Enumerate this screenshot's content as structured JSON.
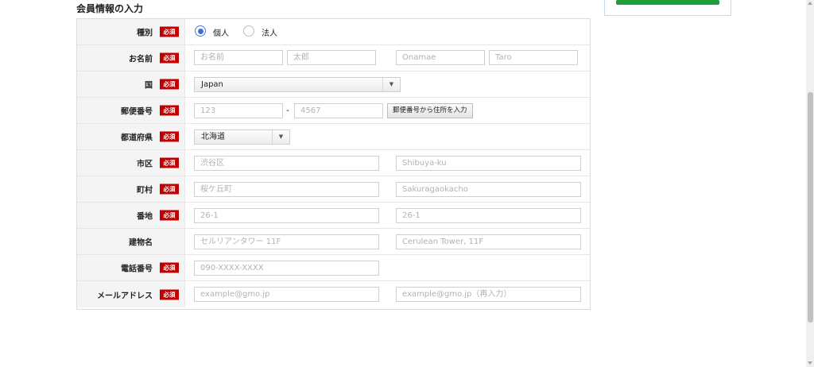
{
  "section_title": "会員情報の入力",
  "required_label": "必須",
  "rows": {
    "type": {
      "label": "種別",
      "options": [
        {
          "label": "個人",
          "checked": true
        },
        {
          "label": "法人",
          "checked": false
        }
      ]
    },
    "name": {
      "label": "お名前",
      "placeholders": [
        "お名前",
        "太郎",
        "Onamae",
        "Taro"
      ]
    },
    "country": {
      "label": "国",
      "selected": "Japan"
    },
    "postal": {
      "label": "郵便番号",
      "placeholders": [
        "123",
        "4567"
      ],
      "separator": "-",
      "button": "郵便番号から住所を入力"
    },
    "prefecture": {
      "label": "都道府県",
      "selected": "北海道"
    },
    "city": {
      "label": "市区",
      "placeholders": [
        "渋谷区",
        "Shibuya-ku"
      ]
    },
    "town": {
      "label": "町村",
      "placeholders": [
        "桜ケ丘町",
        "Sakuragaokacho"
      ]
    },
    "block": {
      "label": "番地",
      "placeholders": [
        "26-1",
        "26-1"
      ]
    },
    "building": {
      "label": "建物名",
      "placeholders": [
        "セルリアンタワー 11F",
        "Cerulean Tower, 11F"
      ]
    },
    "phone": {
      "label": "電話番号",
      "placeholders": [
        "090-XXXX-XXXX"
      ]
    },
    "email": {
      "label": "メールアドレス",
      "placeholders": [
        "example@gmo.jp",
        "example@gmo.jp（再入力）"
      ]
    }
  },
  "colors": {
    "required_badge": "#c00000",
    "radio_checked": "#3b6ed6",
    "side_button": "#1e9e3a"
  }
}
